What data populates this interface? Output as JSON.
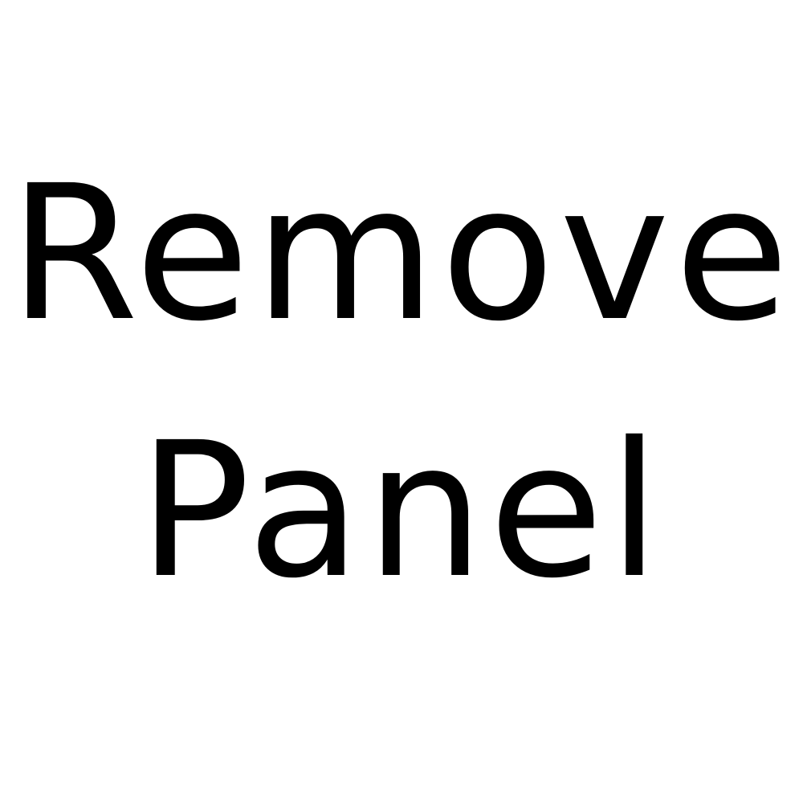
{
  "label": {
    "line1": "Remove",
    "line2": "Panel"
  },
  "colors": {
    "background": "#ffffff",
    "text": "#000000"
  }
}
